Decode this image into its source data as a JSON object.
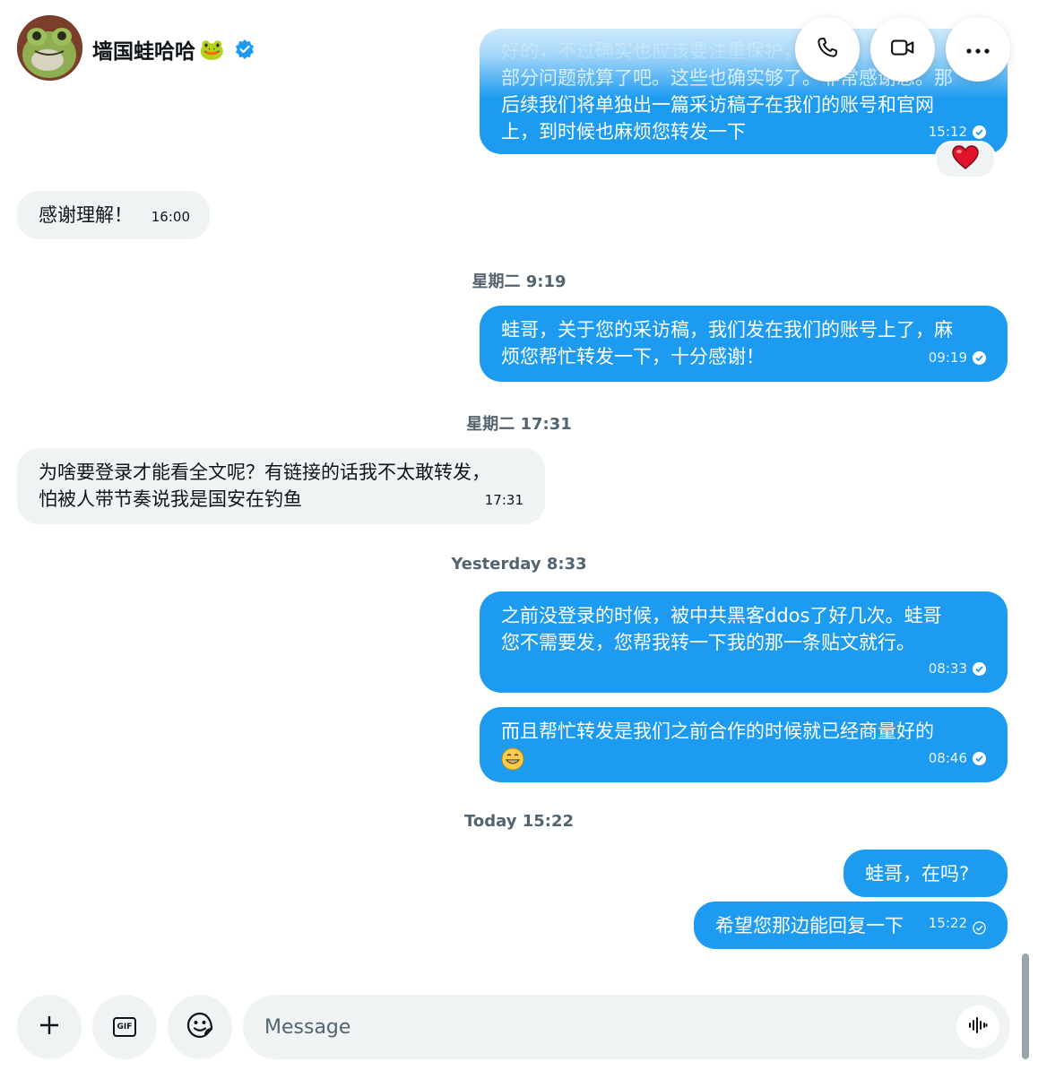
{
  "header": {
    "contact_name": "墙国蛙哈哈",
    "name_emoji": "🐸",
    "icons": [
      "phone-icon",
      "video-icon",
      "more-icon",
      "verified-badge-icon"
    ]
  },
  "messages": [
    {
      "dir": "out",
      "text": "好的，不过确实也应该要注重保护，部分问题就算了吧。这些也确实够了。非常感谢您。那后续我们将单独出一篇采访稿子在我们的账号和官网上，到时候也麻烦您转发一下",
      "time": "15:12"
    },
    {
      "dir": "in",
      "text": "感谢理解！",
      "time": "16:00"
    },
    {
      "dir": "out",
      "text": "蛙哥，关于您的采访稿，我们发在我们的账号上了，麻烦您帮忙转发一下，十分感谢！",
      "time": "09:19"
    },
    {
      "dir": "in",
      "text": "为啥要登录才能看全文呢？有链接的话我不太敢转发，怕被人带节奏说我是国安在钓鱼",
      "time": "17:31"
    },
    {
      "dir": "out",
      "text": "之前没登录的时候，被中共黑客ddos了好几次。蛙哥您不需要发，您帮我转一下我的那一条贴文就行。",
      "time": "08:33"
    },
    {
      "dir": "out",
      "text": "而且帮忙转发是我们之前合作的时候就已经商量好的",
      "emoji": "😁",
      "time": "08:46"
    },
    {
      "dir": "out",
      "text": "蛙哥，在吗?",
      "time": ""
    },
    {
      "dir": "out",
      "text": "希望您那边能回复一下",
      "time": "15:22"
    }
  ],
  "first_message_lines": [
    "好的，不过确实也应该要注重保护，",
    "部分问题就算了吧。这些也确实够了。非常感谢您。那",
    "后续我们将单独出一篇采访稿子在我们的账号和官网",
    "上，到时候也麻烦您转发一下"
  ],
  "msg3_lines": [
    "蛙哥，关于您的采访稿，我们发在我们的账号上了，麻",
    "烦您帮忙转发一下，十分感谢！"
  ],
  "msg4_lines": [
    "为啥要登录才能看全文呢？有链接的话我不太敢转发，",
    "怕被人带节奏说我是国安在钓鱼"
  ],
  "msg5_lines": [
    "之前没登录的时候，被中共黑客ddos了好几次。蛙哥",
    "您不需要发，您帮我转一下我的那一条贴文就行。"
  ],
  "reaction": "❤️",
  "day_separators": [
    "星期二 9:19",
    "星期二 17:31",
    "Yesterday 8:33",
    "Today 15:22"
  ],
  "composer": {
    "placeholder": "Message",
    "buttons": [
      "add-icon",
      "gif-icon",
      "emoji-icon",
      "voice-icon"
    ],
    "gif_label": "GIF"
  }
}
